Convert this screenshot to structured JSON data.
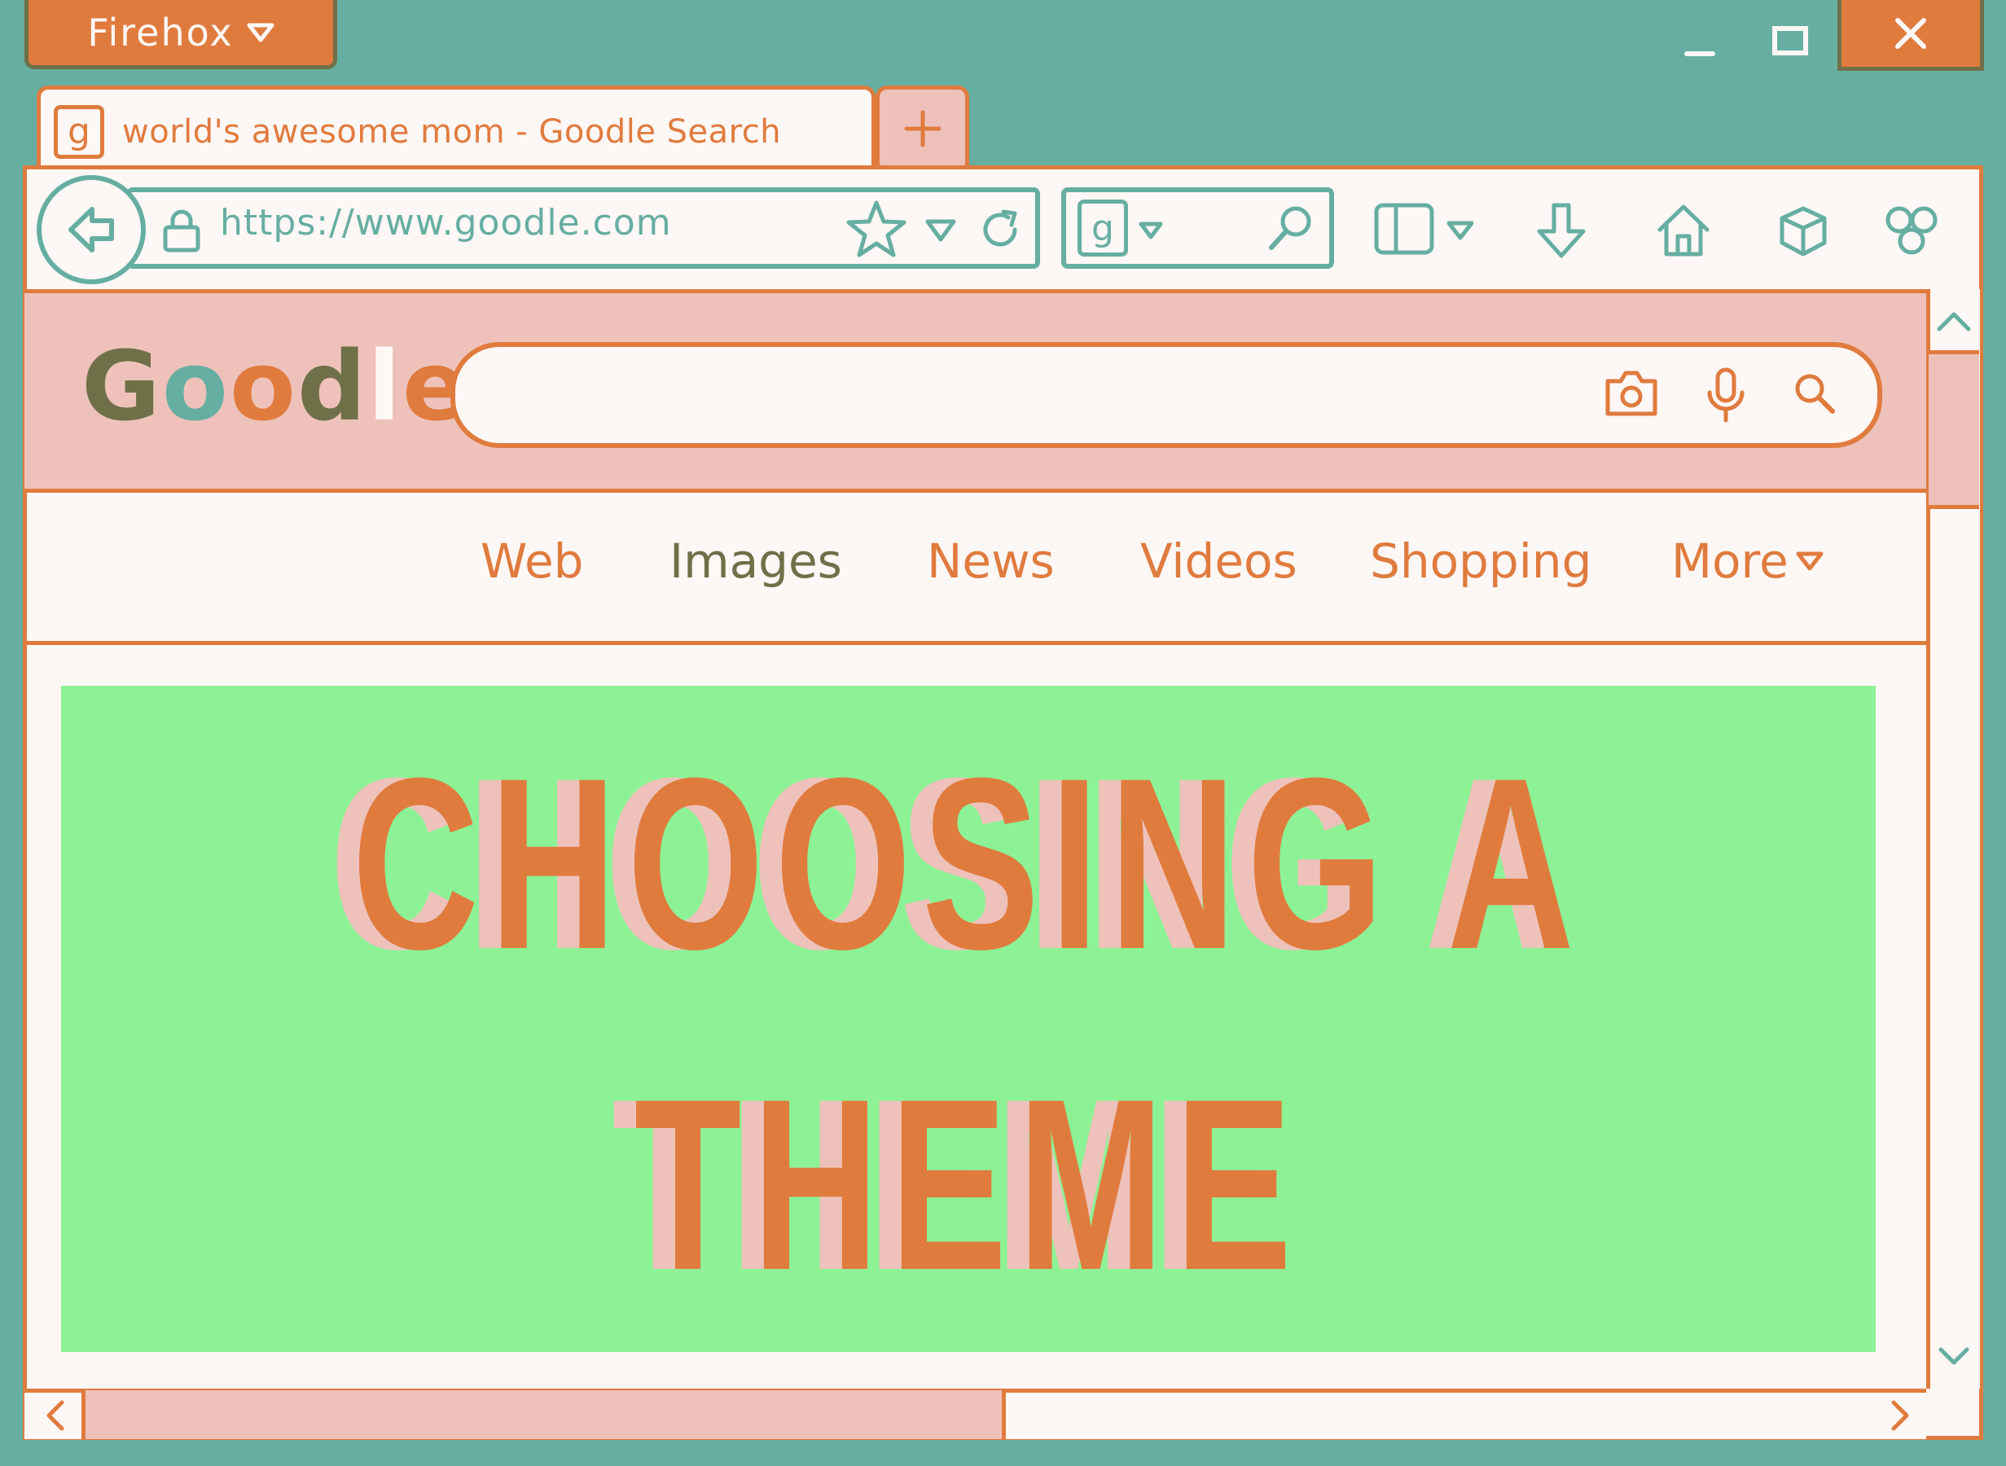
{
  "window": {
    "app_menu_label": "Firehox",
    "tab_title": "world's awesome mom - Goodle Search",
    "tab_favicon": "g",
    "icons": {
      "app_menu": "caret-down-icon",
      "minimize": "minimize-icon",
      "maximize": "maximize-icon",
      "close": "close-icon",
      "new_tab": "plus-icon"
    }
  },
  "toolbar": {
    "url": "https://www.goodle.com",
    "search_engine_glyph": "g",
    "icons": [
      "back-arrow-icon",
      "lock-icon",
      "star-icon",
      "caret-down-icon",
      "reload-icon",
      "search-engine-icon",
      "search-icon",
      "sidebar-icon",
      "download-icon",
      "home-icon",
      "cube-icon",
      "extensions-icon"
    ]
  },
  "search": {
    "logo_letters": [
      "G",
      "o",
      "o",
      "d",
      "l",
      "e"
    ],
    "logo_colors": [
      "#6F7048",
      "#66AEA2",
      "#E07B3E",
      "#6F7048",
      "#FDF7F5",
      "#E07B3E"
    ],
    "input_value": "",
    "icons": [
      "camera-icon",
      "microphone-icon",
      "search-icon"
    ]
  },
  "nav": {
    "items": [
      {
        "label": "Web",
        "color": "#E07B3E"
      },
      {
        "label": "Images",
        "color": "#6F7048"
      },
      {
        "label": "News",
        "color": "#E07B3E"
      },
      {
        "label": "Videos",
        "color": "#E07B3E"
      },
      {
        "label": "Shopping",
        "color": "#E07B3E"
      },
      {
        "label": "More",
        "color": "#E07B3E"
      }
    ]
  },
  "content": {
    "headline_line1": "CHOOSING A",
    "headline_line2": "THEME",
    "background": "#8CF295"
  },
  "colors": {
    "teal": "#66AEA2",
    "orange": "#E07B3E",
    "pink": "#EEC2BA",
    "cream": "#FDF7F5",
    "olive": "#6F7048"
  }
}
